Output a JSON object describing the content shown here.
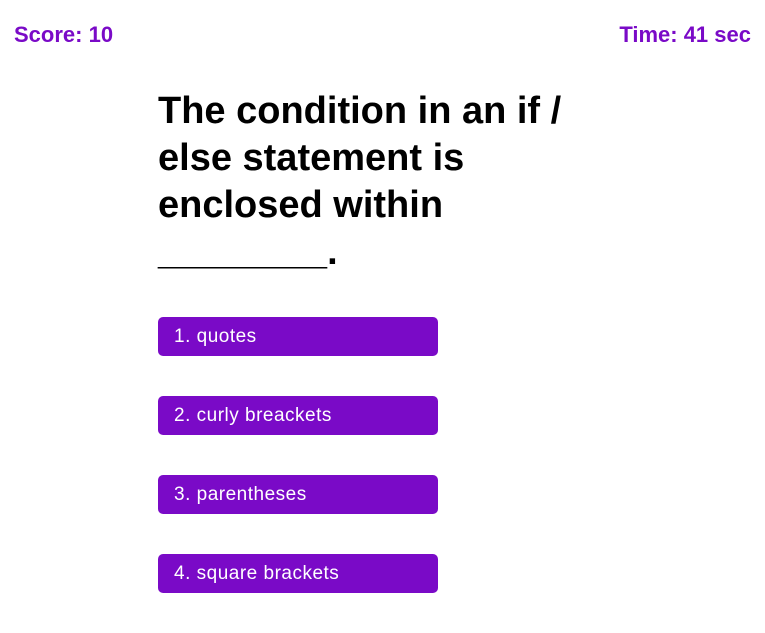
{
  "header": {
    "score": "Score: 10",
    "timer": "Time: 41 sec"
  },
  "question": {
    "text": "The condition in an if / else statement is enclosed within ________."
  },
  "choices": [
    "1. quotes",
    "2. curly breackets",
    "3. parentheses",
    "4. square brackets"
  ],
  "colors": {
    "accent": "#7a0ac7",
    "button_text": "#ffffff",
    "question_text": "#000000",
    "background": "#ffffff"
  }
}
